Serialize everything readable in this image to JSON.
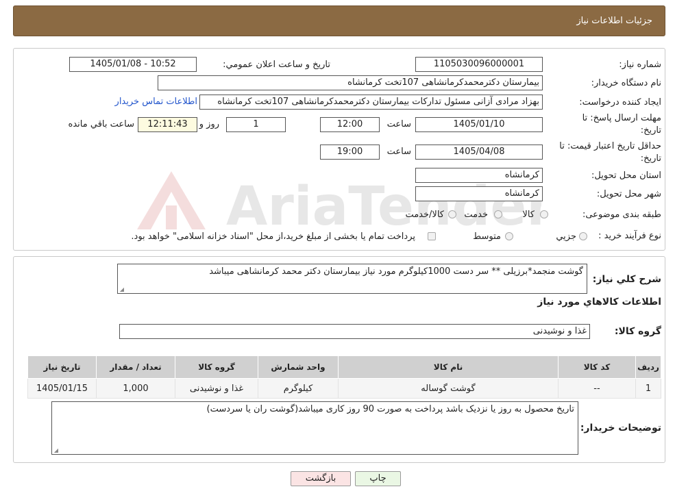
{
  "header": {
    "title": "جزئیات اطلاعات نیاز"
  },
  "form": {
    "need_number_label": "شماره نیاز:",
    "need_number": "1105030096000001",
    "announce_label": "تاریخ و ساعت اعلان عمومي:",
    "announce_value": "1405/01/08 - 10:52",
    "buyer_org_label": "نام دستگاه خريدار:",
    "buyer_org": "بیمارستان دکترمحمدکرمانشاهی 107تخت کرمانشاه",
    "creator_label": "ايجاد کننده درخواست:",
    "creator": "بهزاد مرادی آزانی مسئول تدارکات بیمارستان دکترمحمدکرمانشاهی 107تخت کرمانشاه",
    "contact_link": "اطلاعات تماس خريدار",
    "deadline_label_1": "مهلت ارسال پاسخ: تا",
    "deadline_label_2": "تاريخ:",
    "deadline_date": "1405/01/10",
    "time_label": "ساعت",
    "deadline_time": "12:00",
    "days_value": "1",
    "days_label": "روز و",
    "remaining_time": "12:11:43",
    "remaining_label": "ساعت باقي مانده",
    "validity_label_1": "حداقل تاريخ اعتبار قيمت: تا",
    "validity_label_2": "تاريخ:",
    "validity_date": "1405/04/08",
    "validity_time": "19:00",
    "province_label": "استان محل تحويل:",
    "province": "کرمانشاه",
    "city_label": "شهر محل تحويل:",
    "city": "کرمانشاه",
    "category_label": "طبقه بندی موضوعی:",
    "category_options": [
      "کالا",
      "خدمت",
      "کالا/خدمت"
    ],
    "process_label": "نوع فرآيند خريد :",
    "process_options": [
      "جزيي",
      "متوسط"
    ],
    "process_note": "پرداخت تمام يا بخشی از مبلغ خريد،از محل \"اسناد خزانه اسلامی\" خواهد بود."
  },
  "summary": {
    "label": "شرح کلي نياز:",
    "text": "گوشت منجمد*برزیلی ** سر دست 1000کیلوگرم مورد نیاز بیمارستان دکتر محمد کرمانشاهی میباشد",
    "items_heading": "اطلاعات کالاهاي مورد نياز",
    "group_label": "گروه کالا:",
    "group_value": "غذا و نوشیدنی"
  },
  "table": {
    "headers": [
      "رديف",
      "کد کالا",
      "نام کالا",
      "واحد شمارش",
      "گروه کالا",
      "تعداد / مقدار",
      "تاريخ نياز"
    ],
    "rows": [
      [
        "1",
        "--",
        "گوشت گوساله",
        "کیلوگرم",
        "غذا و نوشیدنی",
        "1,000",
        "1405/01/15"
      ]
    ]
  },
  "buyer_notes": {
    "label": "توضيحات خريدار:",
    "text": "تاریخ محصول به روز یا نزدیک باشد پرداخت به صورت 90 روز کاری میباشد(گوشت ران یا   سردست)"
  },
  "buttons": {
    "print": "چاپ",
    "back": "بازگشت"
  },
  "watermark": {
    "text": "AriaTender.neT"
  },
  "colors": {
    "header_bg": "#8b6a43",
    "link": "#2255cc",
    "print_btn": "#eaf7e4",
    "back_btn": "#fbe4e4"
  }
}
